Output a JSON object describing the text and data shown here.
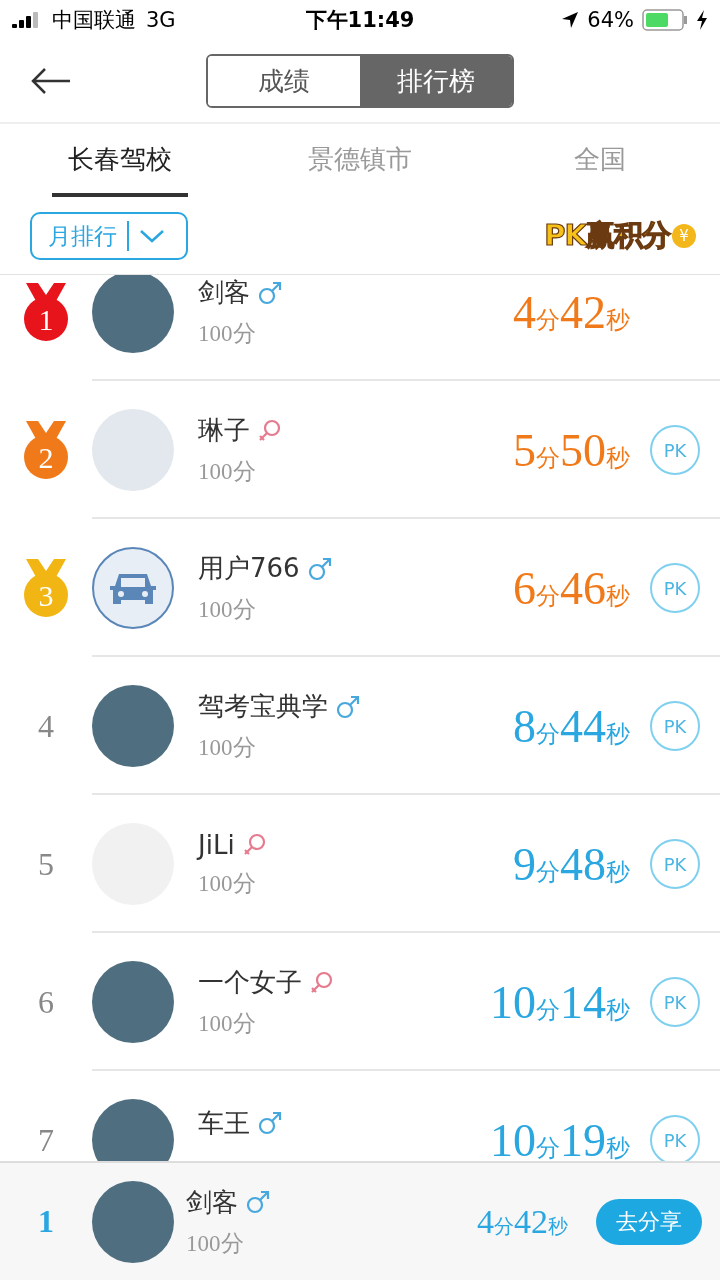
{
  "status_bar": {
    "carrier": "中国联通",
    "network": "3G",
    "time": "下午11:49",
    "battery": "64%"
  },
  "header": {
    "segments": [
      {
        "label": "成绩",
        "selected": false
      },
      {
        "label": "排行榜",
        "selected": true
      }
    ]
  },
  "tabs": [
    {
      "label": "长春驾校",
      "selected": true
    },
    {
      "label": "景德镇市",
      "selected": false
    },
    {
      "label": "全国",
      "selected": false
    }
  ],
  "filter": {
    "label": "月排行"
  },
  "promo": {
    "text": "PK赢积分",
    "coin": "¥"
  },
  "rows": [
    {
      "rank": "1",
      "medal": true,
      "color": "#e8141c",
      "name": "剑客",
      "female": false,
      "avatar": {
        "kind": "photo"
      },
      "score": "100分",
      "time": "4分42秒"
    },
    {
      "rank": "2",
      "medal": true,
      "color": "#f07a1a",
      "name": "琳子",
      "female": true,
      "avatar": {
        "kind": "placeholder"
      },
      "score": "100分",
      "time": "5分50秒",
      "pk_label": "PK"
    },
    {
      "rank": "3",
      "medal": true,
      "color": "#f2b614",
      "name": "用户766",
      "female": false,
      "avatar": {
        "kind": "car"
      },
      "score": "100分",
      "time": "6分46秒",
      "pk_label": "PK"
    },
    {
      "rank": "4",
      "medal": false,
      "name": "驾考宝典学",
      "female": false,
      "avatar": {
        "kind": "photo"
      },
      "score": "100分",
      "time": "8分44秒",
      "pk_label": "PK"
    },
    {
      "rank": "5",
      "medal": false,
      "name": "JiLi",
      "female": true,
      "avatar": {
        "kind": "sketch"
      },
      "score": "100分",
      "time": "9分48秒",
      "pk_label": "PK"
    },
    {
      "rank": "6",
      "medal": false,
      "name": "一个女子",
      "female": true,
      "avatar": {
        "kind": "photo"
      },
      "score": "100分",
      "time": "10分14秒",
      "pk_label": "PK"
    },
    {
      "rank": "7",
      "medal": false,
      "name": "车王",
      "female": false,
      "avatar": {
        "kind": "photo"
      },
      "time": "10分19秒",
      "pk_label": "PK"
    }
  ],
  "my_rank": {
    "rank": "1",
    "name": "剑客",
    "female": false,
    "score": "100分",
    "time": "4分42秒",
    "share": "去分享"
  }
}
